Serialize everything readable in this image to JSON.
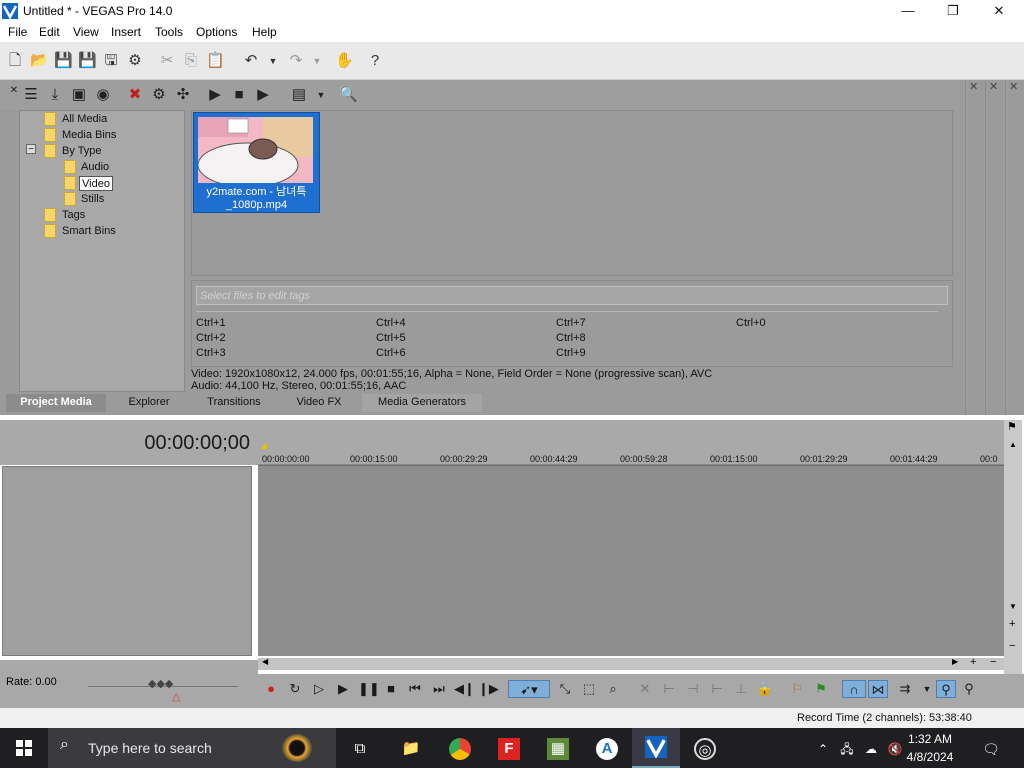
{
  "window": {
    "title": "Untitled * - VEGAS Pro 14.0",
    "minimize": "—",
    "maximize": "❐",
    "close": "✕"
  },
  "menu": [
    "File",
    "Edit",
    "View",
    "Insert",
    "Tools",
    "Options",
    "Help"
  ],
  "tree": {
    "items": [
      "All Media",
      "Media Bins",
      "By Type",
      "Audio",
      "Video",
      "Stills",
      "Tags",
      "Smart Bins"
    ],
    "expander": "−"
  },
  "media": {
    "file_name": "y2mate.com - 남녀특_1080p.mp4"
  },
  "tags": {
    "placeholder": "Select files to edit tags",
    "shortcuts": [
      "Ctrl+1",
      "Ctrl+4",
      "Ctrl+7",
      "Ctrl+0",
      "Ctrl+2",
      "Ctrl+5",
      "Ctrl+8",
      "Ctrl+3",
      "Ctrl+6",
      "Ctrl+9"
    ]
  },
  "info": {
    "video": "Video: 1920x1080x12, 24.000 fps, 00:01:55;16, Alpha = None, Field Order = None (progressive scan), AVC",
    "audio": "Audio: 44,100 Hz, Stereo, 00:01:55;16, AAC"
  },
  "tabs": [
    "Project Media",
    "Explorer",
    "Transitions",
    "Video FX",
    "Media Generators"
  ],
  "timeline": {
    "time": "00:00:00;00",
    "ruler": [
      "00:00:00:00",
      "00:00:15:00",
      "00:00:29:29",
      "00:00:44:29",
      "00:00:59:28",
      "00:01:15:00",
      "00:01:29:29",
      "00:01:44:29",
      "00:0"
    ],
    "rate": "Rate: 0.00"
  },
  "status": {
    "record_time": "Record Time (2 channels): 53:38:40"
  },
  "taskbar": {
    "search": "Type here to search",
    "time": "1:32 AM",
    "date": "4/8/2024"
  },
  "colors": {
    "selection": "#1e6fd0",
    "panel": "#9b9b9b",
    "taskbar": "#1f1f22"
  }
}
